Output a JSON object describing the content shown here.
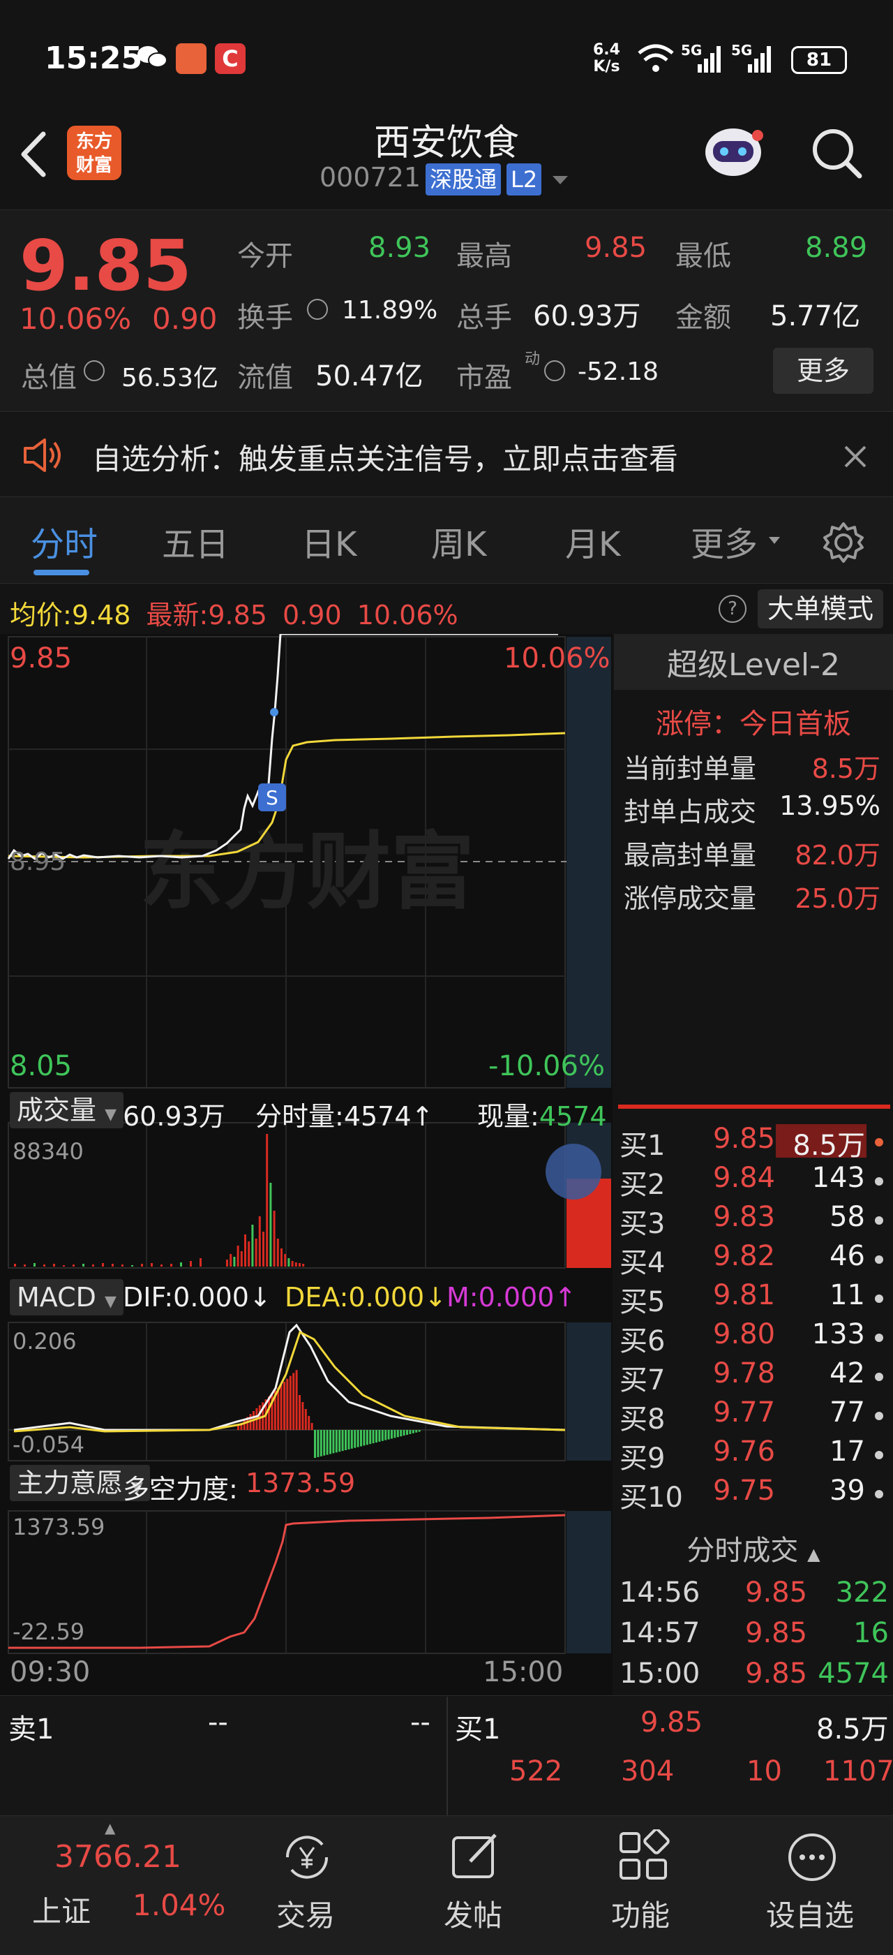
{
  "status_bar": {
    "time": "15:25",
    "net_speed_top": "6.4",
    "net_speed_unit": "K/s",
    "battery": "81",
    "sig1": "5G",
    "sig2": "5G"
  },
  "header": {
    "logo_text_1": "东方",
    "logo_text_2": "财富",
    "title": "西安饮食",
    "code": "000721",
    "badge": "深股通",
    "level": "L2"
  },
  "quote": {
    "price": "9.85",
    "change_pct": "10.06%",
    "change": "0.90",
    "open_label": "今开",
    "open": "8.93",
    "high_label": "最高",
    "high": "9.85",
    "low_label": "最低",
    "low": "8.89",
    "turnover_label": "换手",
    "turnover": "11.89%",
    "volume_label": "总手",
    "volume": "60.93万",
    "amount_label": "金额",
    "amount": "5.77亿",
    "mktcap_label": "总值",
    "mktcap": "56.53亿",
    "float_label": "流值",
    "float": "50.47亿",
    "pe_label": "市盈",
    "pe_sup": "动",
    "pe": "-52.18",
    "more": "更多"
  },
  "alert": {
    "text": "自选分析：触发重点关注信号，立即点击查看"
  },
  "tabs": [
    "分时",
    "五日",
    "日K",
    "周K",
    "月K",
    "更多"
  ],
  "chart_header": {
    "avg_label": "均价:",
    "avg": "9.48",
    "latest_label": "最新:",
    "latest": "9.85",
    "latest_change": "0.90",
    "latest_pct": "10.06%",
    "mode": "大单模式"
  },
  "price_chart": {
    "top_price": "9.85",
    "top_pct": "10.06%",
    "bottom_price": "8.05",
    "bottom_pct": "-10.06%",
    "mid_price": "8.95",
    "watermark": "东方财富",
    "marker": "S"
  },
  "volume_bar": {
    "label": "成交量",
    "total": "60.93万",
    "tick_label": "分时量:",
    "tick": "4574",
    "cur_label": "现量:",
    "cur": "4574",
    "max": "88340"
  },
  "macd_bar": {
    "label": "MACD",
    "dif": "DIF:0.000",
    "dea": "DEA:0.000",
    "m": "M:0.000",
    "top": "0.206",
    "bottom": "-0.054"
  },
  "main_bar": {
    "label": "主力意愿",
    "name": "多空力度:",
    "value": "1373.59",
    "top": "1373.59",
    "bottom": "-22.59"
  },
  "time_axis": {
    "start": "09:30",
    "end": "15:00"
  },
  "level2": {
    "title": "超级Level-2",
    "limit_label": "涨停：今日首板",
    "rows": [
      {
        "label": "当前封单量",
        "value": "8.5万"
      },
      {
        "label": "封单占成交",
        "value": "13.95%"
      },
      {
        "label": "最高封单量",
        "value": "82.0万"
      },
      {
        "label": "涨停成交量",
        "value": "25.0万"
      }
    ]
  },
  "order_book": [
    {
      "label": "买1",
      "price": "9.85",
      "vol": "8.5万"
    },
    {
      "label": "买2",
      "price": "9.84",
      "vol": "143"
    },
    {
      "label": "买3",
      "price": "9.83",
      "vol": "58"
    },
    {
      "label": "买4",
      "price": "9.82",
      "vol": "46"
    },
    {
      "label": "买5",
      "price": "9.81",
      "vol": "11"
    },
    {
      "label": "买6",
      "price": "9.80",
      "vol": "133"
    },
    {
      "label": "买7",
      "price": "9.78",
      "vol": "42"
    },
    {
      "label": "买8",
      "price": "9.77",
      "vol": "77"
    },
    {
      "label": "买9",
      "price": "9.76",
      "vol": "17"
    },
    {
      "label": "买10",
      "price": "9.75",
      "vol": "39"
    }
  ],
  "ticks": {
    "title": "分时成交",
    "rows": [
      {
        "time": "14:56",
        "price": "9.85",
        "vol": "322"
      },
      {
        "time": "14:57",
        "price": "9.85",
        "vol": "16"
      },
      {
        "time": "15:00",
        "price": "9.85",
        "vol": "4574"
      }
    ]
  },
  "bottom_table": {
    "sell_label": "卖1",
    "sell_a": "--",
    "sell_b": "--",
    "buy_label": "买1",
    "buy_price": "9.85",
    "buy_vol": "8.5万",
    "r2": [
      "522",
      "304",
      "10",
      "1107"
    ]
  },
  "bottom_nav": {
    "index_value": "3766.21",
    "index_name": "上证",
    "index_pct": "1.04%",
    "items": [
      "交易",
      "发帖",
      "功能",
      "设自选"
    ]
  }
}
